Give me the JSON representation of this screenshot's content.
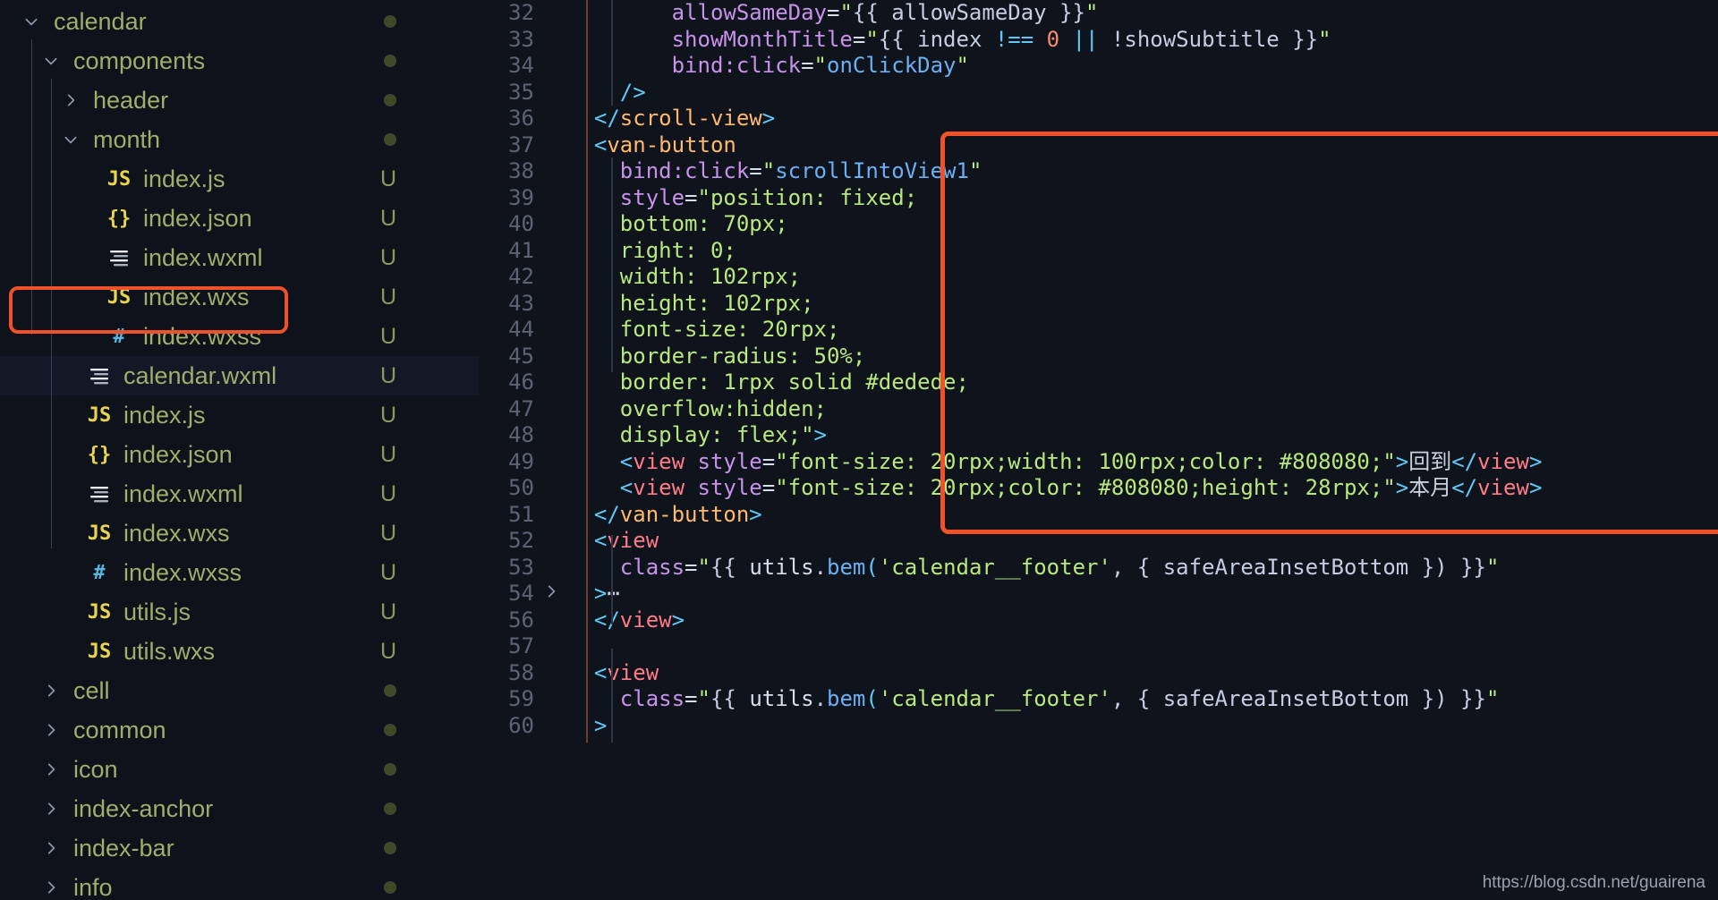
{
  "colors": {
    "background": "#0f131c",
    "sidebar_bg": "#0d121b",
    "annotation": "#f0502a",
    "tree_text": "#a1ad6b",
    "line_number": "#5c6474"
  },
  "sidebar": {
    "items": [
      {
        "label": "calendar",
        "kind": "folder",
        "state": "expanded",
        "indent": 0,
        "status": "dot",
        "icon": "chevron-down-icon"
      },
      {
        "label": "components",
        "kind": "folder",
        "state": "expanded",
        "indent": 1,
        "status": "dot",
        "icon": "chevron-down-icon"
      },
      {
        "label": "header",
        "kind": "folder",
        "state": "collapsed",
        "indent": 2,
        "status": "dot",
        "icon": "chevron-right-icon"
      },
      {
        "label": "month",
        "kind": "folder",
        "state": "expanded",
        "indent": 2,
        "status": "dot",
        "icon": "chevron-down-icon"
      },
      {
        "label": "index.js",
        "kind": "file",
        "filetype": "js",
        "indent": 3,
        "status": "U",
        "icon": "js-file-icon"
      },
      {
        "label": "index.json",
        "kind": "file",
        "filetype": "json",
        "indent": 3,
        "status": "U",
        "icon": "json-file-icon"
      },
      {
        "label": "index.wxml",
        "kind": "file",
        "filetype": "wxml",
        "indent": 3,
        "status": "U",
        "icon": "wxml-file-icon"
      },
      {
        "label": "index.wxs",
        "kind": "file",
        "filetype": "js",
        "indent": 3,
        "status": "U",
        "icon": "js-file-icon"
      },
      {
        "label": "index.wxss",
        "kind": "file",
        "filetype": "wxss",
        "indent": 3,
        "status": "U",
        "icon": "wxss-file-icon"
      },
      {
        "label": "calendar.wxml",
        "kind": "file",
        "filetype": "wxml",
        "indent": 2,
        "status": "U",
        "icon": "wxml-file-icon",
        "selected": true
      },
      {
        "label": "index.js",
        "kind": "file",
        "filetype": "js",
        "indent": 2,
        "status": "U",
        "icon": "js-file-icon"
      },
      {
        "label": "index.json",
        "kind": "file",
        "filetype": "json",
        "indent": 2,
        "status": "U",
        "icon": "json-file-icon"
      },
      {
        "label": "index.wxml",
        "kind": "file",
        "filetype": "wxml",
        "indent": 2,
        "status": "U",
        "icon": "wxml-file-icon"
      },
      {
        "label": "index.wxs",
        "kind": "file",
        "filetype": "js",
        "indent": 2,
        "status": "U",
        "icon": "js-file-icon"
      },
      {
        "label": "index.wxss",
        "kind": "file",
        "filetype": "wxss",
        "indent": 2,
        "status": "U",
        "icon": "wxss-file-icon"
      },
      {
        "label": "utils.js",
        "kind": "file",
        "filetype": "js",
        "indent": 2,
        "status": "U",
        "icon": "js-file-icon"
      },
      {
        "label": "utils.wxs",
        "kind": "file",
        "filetype": "js",
        "indent": 2,
        "status": "U",
        "icon": "js-file-icon"
      },
      {
        "label": "cell",
        "kind": "folder",
        "state": "collapsed",
        "indent": 1,
        "status": "dot",
        "icon": "chevron-right-icon"
      },
      {
        "label": "common",
        "kind": "folder",
        "state": "collapsed",
        "indent": 1,
        "status": "dot",
        "icon": "chevron-right-icon"
      },
      {
        "label": "icon",
        "kind": "folder",
        "state": "collapsed",
        "indent": 1,
        "status": "dot",
        "icon": "chevron-right-icon"
      },
      {
        "label": "index-anchor",
        "kind": "folder",
        "state": "collapsed",
        "indent": 1,
        "status": "dot",
        "icon": "chevron-right-icon"
      },
      {
        "label": "index-bar",
        "kind": "folder",
        "state": "collapsed",
        "indent": 1,
        "status": "dot",
        "icon": "chevron-right-icon"
      },
      {
        "label": "info",
        "kind": "folder",
        "state": "collapsed",
        "indent": 1,
        "status": "dot",
        "icon": "chevron-right-icon"
      }
    ]
  },
  "editor": {
    "first_line_number": 32,
    "lines": [
      {
        "n": 32,
        "indent": 4,
        "fold": "",
        "tokens": [
          {
            "c": "t-attr",
            "t": "allowSameDay"
          },
          {
            "c": "t-op",
            "t": "="
          },
          {
            "c": "t-q",
            "t": "\""
          },
          {
            "c": "t-mus",
            "t": "{{ allowSameDay }}"
          },
          {
            "c": "t-q",
            "t": "\""
          }
        ]
      },
      {
        "n": 33,
        "indent": 4,
        "fold": "",
        "tokens": [
          {
            "c": "t-attr",
            "t": "showMonthTitle"
          },
          {
            "c": "t-op",
            "t": "="
          },
          {
            "c": "t-q",
            "t": "\""
          },
          {
            "c": "t-mus",
            "t": "{{ index "
          },
          {
            "c": "t-brk",
            "t": "!=="
          },
          {
            "c": "t-mus",
            "t": " "
          },
          {
            "c": "t-num",
            "t": "0"
          },
          {
            "c": "t-mus",
            "t": " "
          },
          {
            "c": "t-brk",
            "t": "||"
          },
          {
            "c": "t-mus",
            "t": " !showSubtitle }}"
          },
          {
            "c": "t-q",
            "t": "\""
          }
        ]
      },
      {
        "n": 34,
        "indent": 4,
        "fold": "",
        "tokens": [
          {
            "c": "t-attr",
            "t": "bind:click"
          },
          {
            "c": "t-op",
            "t": "="
          },
          {
            "c": "t-q",
            "t": "\""
          },
          {
            "c": "t-fn",
            "t": "onClickDay"
          },
          {
            "c": "t-q",
            "t": "\""
          }
        ]
      },
      {
        "n": 35,
        "indent": 2,
        "fold": "",
        "tokens": [
          {
            "c": "t-brk",
            "t": "/>"
          }
        ]
      },
      {
        "n": 36,
        "indent": 1,
        "fold": "",
        "tokens": [
          {
            "c": "t-brk",
            "t": "</"
          },
          {
            "c": "t-tag",
            "t": "scroll-view"
          },
          {
            "c": "t-brk",
            "t": ">"
          }
        ]
      },
      {
        "n": 37,
        "indent": 1,
        "fold": "",
        "tokens": [
          {
            "c": "t-brk",
            "t": "<"
          },
          {
            "c": "t-tag",
            "t": "van-button"
          }
        ]
      },
      {
        "n": 38,
        "indent": 2,
        "fold": "",
        "tokens": [
          {
            "c": "t-attr",
            "t": "bind:click"
          },
          {
            "c": "t-op",
            "t": "="
          },
          {
            "c": "t-q",
            "t": "\""
          },
          {
            "c": "t-fn",
            "t": "scrollIntoView1"
          },
          {
            "c": "t-q",
            "t": "\""
          }
        ]
      },
      {
        "n": 39,
        "indent": 2,
        "fold": "",
        "tokens": [
          {
            "c": "t-attr",
            "t": "style"
          },
          {
            "c": "t-op",
            "t": "="
          },
          {
            "c": "t-q",
            "t": "\""
          },
          {
            "c": "t-str",
            "t": "position: fixed;"
          }
        ]
      },
      {
        "n": 40,
        "indent": 2,
        "fold": "",
        "tokens": [
          {
            "c": "t-str",
            "t": "bottom: 70px;"
          }
        ]
      },
      {
        "n": 41,
        "indent": 2,
        "fold": "",
        "tokens": [
          {
            "c": "t-str",
            "t": "right: 0;"
          }
        ]
      },
      {
        "n": 42,
        "indent": 2,
        "fold": "",
        "tokens": [
          {
            "c": "t-str",
            "t": "width: 102rpx;"
          }
        ]
      },
      {
        "n": 43,
        "indent": 2,
        "fold": "",
        "tokens": [
          {
            "c": "t-str",
            "t": "height: 102rpx;"
          }
        ]
      },
      {
        "n": 44,
        "indent": 2,
        "fold": "",
        "tokens": [
          {
            "c": "t-str",
            "t": "font-size: 20rpx;"
          }
        ]
      },
      {
        "n": 45,
        "indent": 2,
        "fold": "",
        "tokens": [
          {
            "c": "t-str",
            "t": "border-radius: 50%;"
          }
        ]
      },
      {
        "n": 46,
        "indent": 2,
        "fold": "",
        "tokens": [
          {
            "c": "t-str",
            "t": "border: 1rpx solid #dedede;"
          }
        ]
      },
      {
        "n": 47,
        "indent": 2,
        "fold": "",
        "tokens": [
          {
            "c": "t-str",
            "t": "overflow:hidden;"
          }
        ]
      },
      {
        "n": 48,
        "indent": 2,
        "fold": "",
        "tokens": [
          {
            "c": "t-str",
            "t": "display: flex;"
          },
          {
            "c": "t-q",
            "t": "\""
          },
          {
            "c": "t-brk",
            "t": ">"
          }
        ]
      },
      {
        "n": 49,
        "indent": 2,
        "fold": "",
        "tokens": [
          {
            "c": "t-brk",
            "t": "<"
          },
          {
            "c": "t-tagh",
            "t": "view"
          },
          {
            "c": "t-str",
            "t": " "
          },
          {
            "c": "t-attr",
            "t": "style"
          },
          {
            "c": "t-op",
            "t": "="
          },
          {
            "c": "t-q",
            "t": "\""
          },
          {
            "c": "t-str",
            "t": "font-size: 20rpx;width: 100rpx;color: #808080;"
          },
          {
            "c": "t-q",
            "t": "\""
          },
          {
            "c": "t-brk",
            "t": ">"
          },
          {
            "c": "t-cn",
            "t": "回到"
          },
          {
            "c": "t-brk",
            "t": "</"
          },
          {
            "c": "t-tagh",
            "t": "view"
          },
          {
            "c": "t-brk",
            "t": ">"
          }
        ]
      },
      {
        "n": 50,
        "indent": 2,
        "fold": "",
        "tokens": [
          {
            "c": "t-brk",
            "t": "<"
          },
          {
            "c": "t-tagh",
            "t": "view"
          },
          {
            "c": "t-str",
            "t": " "
          },
          {
            "c": "t-attr",
            "t": "style"
          },
          {
            "c": "t-op",
            "t": "="
          },
          {
            "c": "t-q",
            "t": "\""
          },
          {
            "c": "t-str",
            "t": "font-size: 20rpx;color: #808080;height: 28rpx;"
          },
          {
            "c": "t-q",
            "t": "\""
          },
          {
            "c": "t-brk",
            "t": ">"
          },
          {
            "c": "t-cn",
            "t": "本月"
          },
          {
            "c": "t-brk",
            "t": "</"
          },
          {
            "c": "t-tagh",
            "t": "view"
          },
          {
            "c": "t-brk",
            "t": ">"
          }
        ]
      },
      {
        "n": 51,
        "indent": 1,
        "fold": "",
        "tokens": [
          {
            "c": "t-brk",
            "t": "</"
          },
          {
            "c": "t-tag",
            "t": "van-button"
          },
          {
            "c": "t-brk",
            "t": ">"
          }
        ]
      },
      {
        "n": 52,
        "indent": 1,
        "fold": "",
        "tokens": [
          {
            "c": "t-brk",
            "t": "<"
          },
          {
            "c": "t-tagh",
            "t": "view"
          }
        ]
      },
      {
        "n": 53,
        "indent": 2,
        "fold": "",
        "tokens": [
          {
            "c": "t-attr",
            "t": "class"
          },
          {
            "c": "t-op",
            "t": "="
          },
          {
            "c": "t-q",
            "t": "\""
          },
          {
            "c": "t-mus",
            "t": "{{ "
          },
          {
            "c": "t-white",
            "t": "utils"
          },
          {
            "c": "t-punc",
            "t": "."
          },
          {
            "c": "t-fn",
            "t": "bem"
          },
          {
            "c": "t-brk",
            "t": "("
          },
          {
            "c": "t-str",
            "t": "'calendar__footer'"
          },
          {
            "c": "t-punc",
            "t": ", { "
          },
          {
            "c": "t-mus",
            "t": "safeAreaInsetBottom"
          },
          {
            "c": "t-punc",
            "t": " })"
          },
          {
            "c": "t-mus",
            "t": " }}"
          },
          {
            "c": "t-q",
            "t": "\""
          }
        ]
      },
      {
        "n": 54,
        "indent": 1,
        "fold": "chevron-right",
        "tokens": [
          {
            "c": "t-brk",
            "t": ">"
          },
          {
            "c": "t-punc",
            "t": "⋯"
          }
        ]
      },
      {
        "n": 56,
        "indent": 1,
        "fold": "",
        "tokens": [
          {
            "c": "t-brk",
            "t": "</"
          },
          {
            "c": "t-tagh",
            "t": "view"
          },
          {
            "c": "t-brk",
            "t": ">"
          }
        ]
      },
      {
        "n": 57,
        "indent": 0,
        "fold": "",
        "tokens": []
      },
      {
        "n": 58,
        "indent": 1,
        "fold": "",
        "tokens": [
          {
            "c": "t-brk",
            "t": "<"
          },
          {
            "c": "t-tagh",
            "t": "view"
          }
        ]
      },
      {
        "n": 59,
        "indent": 2,
        "fold": "",
        "tokens": [
          {
            "c": "t-attr",
            "t": "class"
          },
          {
            "c": "t-op",
            "t": "="
          },
          {
            "c": "t-q",
            "t": "\""
          },
          {
            "c": "t-mus",
            "t": "{{ "
          },
          {
            "c": "t-white",
            "t": "utils"
          },
          {
            "c": "t-punc",
            "t": "."
          },
          {
            "c": "t-fn",
            "t": "bem"
          },
          {
            "c": "t-brk",
            "t": "("
          },
          {
            "c": "t-str",
            "t": "'calendar__footer'"
          },
          {
            "c": "t-punc",
            "t": ", { "
          },
          {
            "c": "t-mus",
            "t": "safeAreaInsetBottom"
          },
          {
            "c": "t-punc",
            "t": " })"
          },
          {
            "c": "t-mus",
            "t": " }}"
          },
          {
            "c": "t-q",
            "t": "\""
          }
        ]
      },
      {
        "n": 60,
        "indent": 1,
        "fold": "",
        "tokens": [
          {
            "c": "t-brk",
            "t": ">"
          }
        ]
      }
    ]
  },
  "watermark": {
    "text": "https://blog.csdn.net/guairena"
  }
}
